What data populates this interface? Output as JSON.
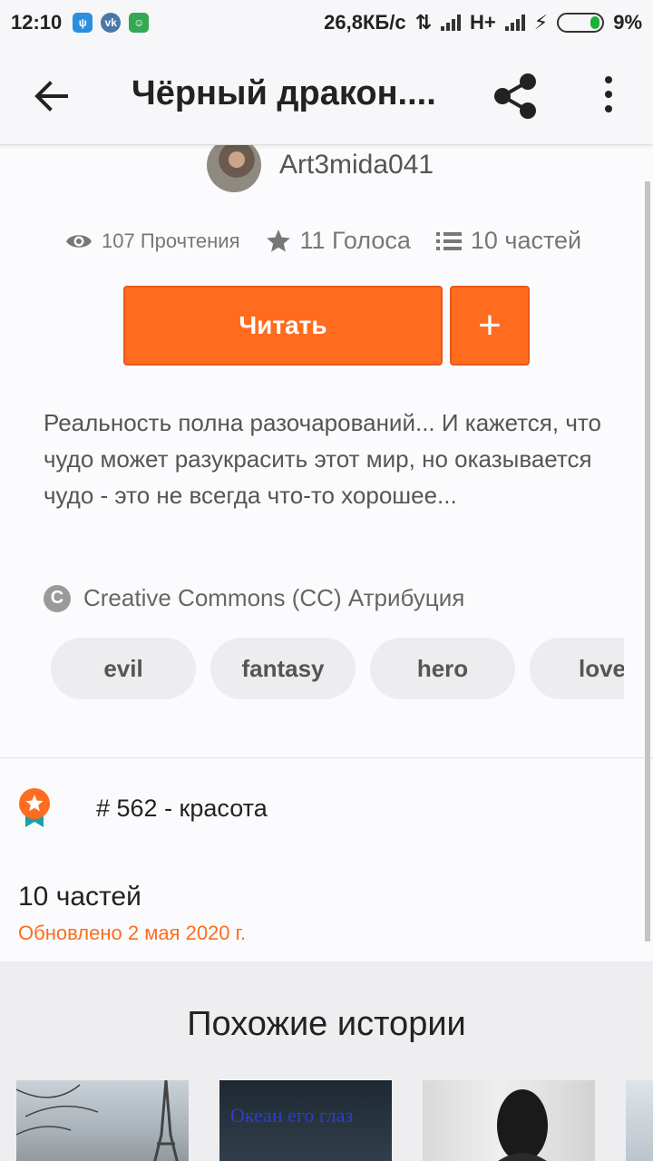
{
  "status_bar": {
    "time": "12:10",
    "network_speed": "26,8КБ/с",
    "network_type": "H+",
    "battery": "9%"
  },
  "app_bar": {
    "title": "Чёрный дракон....",
    "back_icon": "arrow-left-icon",
    "share_icon": "share-icon",
    "more_icon": "more-vertical-icon"
  },
  "story": {
    "author": "Art3mida041",
    "reads": "107 Прочтения",
    "votes": "11 Голоса",
    "parts": "10 частей",
    "read_button": "Читать",
    "add_button": "+",
    "description": "Реальность полна разочарований... И кажется, что чудо может разукрасить этот мир, но оказывается чудо - это не всегда что-то хорошее...",
    "license": "Creative Commons (CC) Атрибуция",
    "license_icon_letter": "C",
    "tags": [
      "evil",
      "fantasy",
      "hero",
      "love"
    ],
    "rank": "# 562 - красота",
    "parts_count": "10 частей",
    "updated": "Обновлено 2 мая 2020 г."
  },
  "similar": {
    "title": "Похожие истории",
    "cover_2_text": "Океан его глаз"
  },
  "colors": {
    "accent": "#ff6c1f",
    "background": "#fbfbfd",
    "tag_bg": "#ededf0"
  }
}
